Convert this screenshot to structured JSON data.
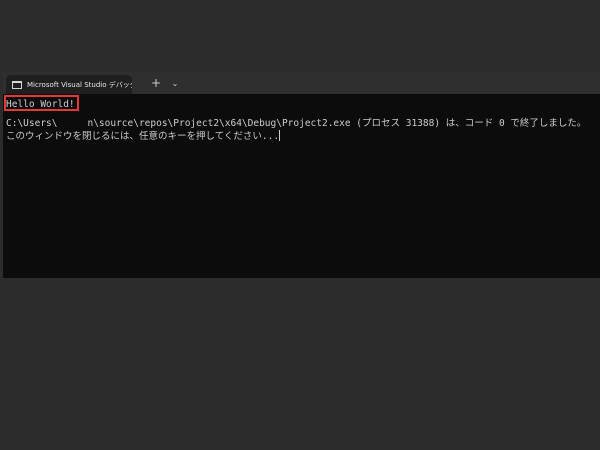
{
  "tab": {
    "title": "Microsoft Visual Studio デバッグ",
    "new_tab_label": "+",
    "dropdown_label": "⌄",
    "icon": "terminal-icon"
  },
  "console": {
    "output_line": "Hello World!",
    "exit_line_user_prefix": "C:\\Users\\",
    "exit_line_rest": "n\\source\\repos\\Project2\\x64\\Debug\\Project2.exe (プロセス 31388) は、コード 0 で終了しました。",
    "prompt_line": "このウィンドウを閉じるには、任意のキーを押してください..."
  },
  "highlight": {
    "color": "#e53935",
    "target": "Hello World!"
  }
}
